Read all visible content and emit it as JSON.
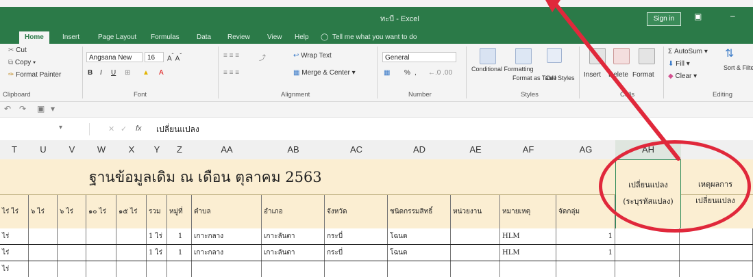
{
  "window": {
    "title": "ทะบี - Excel",
    "signin": "Sign in"
  },
  "tabs": [
    "Home",
    "Insert",
    "Page Layout",
    "Formulas",
    "Data",
    "Review",
    "View",
    "Help"
  ],
  "tell_me": "Tell me what you want to do",
  "ribbon": {
    "clipboard": {
      "cut": "Cut",
      "copy": "Copy",
      "format_painter": "Format Painter",
      "label": "Clipboard"
    },
    "font": {
      "name": "Angsana New",
      "size": "16",
      "label": "Font"
    },
    "alignment": {
      "wrap": "Wrap Text",
      "merge": "Merge & Center",
      "label": "Alignment"
    },
    "number": {
      "format": "General",
      "percent": "%",
      "label": "Number"
    },
    "styles": {
      "conditional": "Conditional Formatting",
      "format_table": "Format as Table",
      "cell_styles": "Cell Styles",
      "label": "Styles"
    },
    "cells": {
      "insert": "Insert",
      "delete": "Delete",
      "format": "Format",
      "label": "Cells"
    },
    "editing": {
      "autosum": "AutoSum",
      "fill": "Fill",
      "clear": "Clear",
      "sort": "Sort & Filter",
      "label": "Editing"
    }
  },
  "formula_bar": {
    "fx": "fx",
    "value": "เปลี่ยนแปลง"
  },
  "columns": [
    "T",
    "U",
    "V",
    "W",
    "X",
    "Y",
    "Z",
    "AA",
    "AB",
    "AC",
    "AD",
    "AE",
    "AF",
    "AG",
    "AH"
  ],
  "sheet_title": "ฐานข้อมูลเดิม ณ เดือน ตุลาคม 2563",
  "headers": [
    "ไร่ ไร่",
    "๖ ไร่",
    "๖ ไร่",
    "๑๐ ไร่",
    "๑๕ ไร่",
    "รวม",
    "หมู่ที่",
    "ตำบล",
    "อำเภอ",
    "จังหวัด",
    "ชนิดกรรมสิทธิ์",
    "หน่วยงาน",
    "หมายเหตุ",
    "จัดกลุ่ม"
  ],
  "change_header": [
    "เปลี่ยนแปลง",
    "(ระบุรหัสแปลง)"
  ],
  "reason_header": [
    "เหตุผลการ",
    "เปลี่ยนแปลง"
  ],
  "rows": [
    {
      "a": "ไร่",
      "y": "1 ไร่",
      "z": "1",
      "aa": "เกาะกลาง",
      "ab": "เกาะลันตา",
      "ac": "กระบี่",
      "ad": "โฉนด",
      "af": "HLM",
      "ag": "1"
    },
    {
      "a": "ไร่",
      "y": "1 ไร่",
      "z": "1",
      "aa": "เกาะกลาง",
      "ab": "เกาะลันตา",
      "ac": "กระบี่",
      "ad": "โฉนด",
      "af": "HLM",
      "ag": "1"
    },
    {
      "a": "ไร่",
      "y": "",
      "z": "",
      "aa": "",
      "ab": "",
      "ac": "",
      "ad": "",
      "af": "",
      "ag": ""
    }
  ],
  "colors": {
    "excel_green": "#2b7a48",
    "band": "#fbeed2",
    "annotation_red": "#e0283b"
  }
}
